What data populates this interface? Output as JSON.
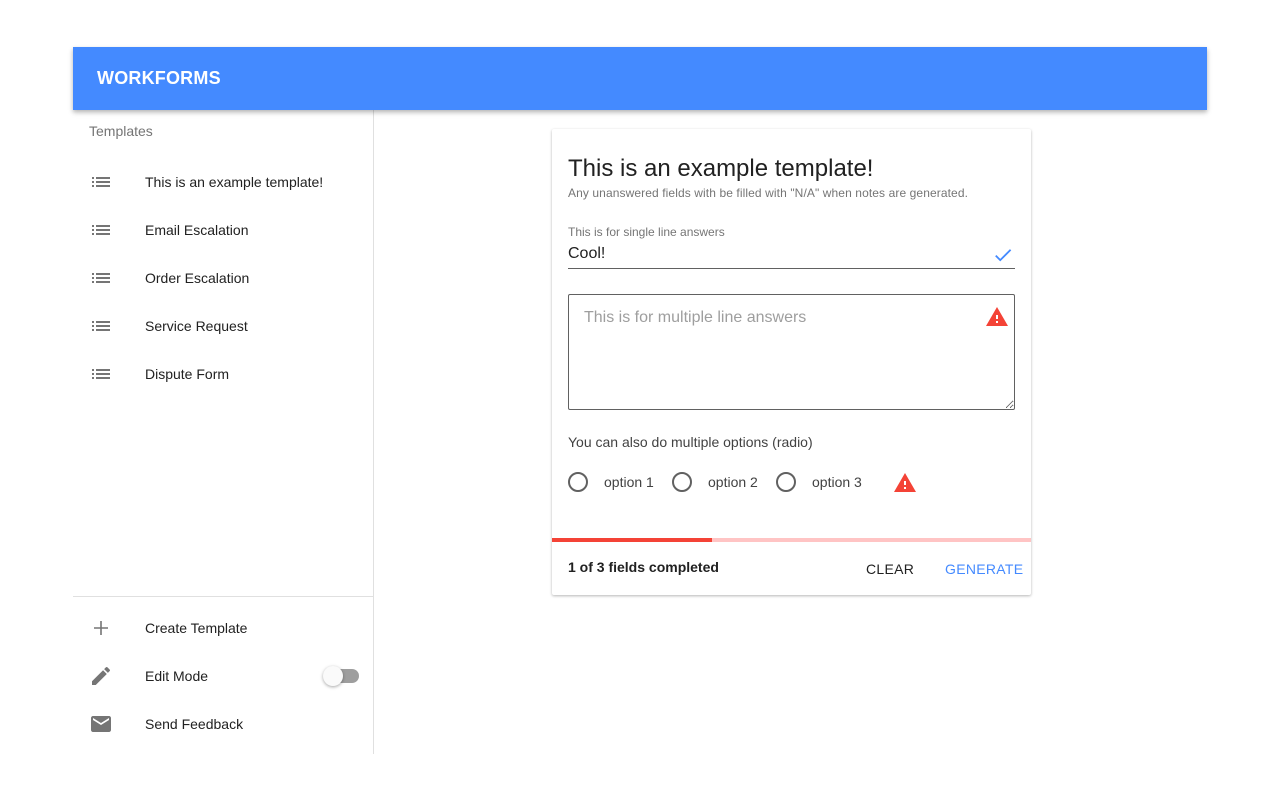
{
  "app": {
    "title": "WORKFORMS",
    "accent_color": "#448aff"
  },
  "sidebar": {
    "subheader": "Templates",
    "templates": [
      {
        "label": "This is an example template!",
        "icon": "list-icon"
      },
      {
        "label": "Email Escalation",
        "icon": "list-icon"
      },
      {
        "label": "Order Escalation",
        "icon": "list-icon"
      },
      {
        "label": "Service Request",
        "icon": "list-icon"
      },
      {
        "label": "Dispute Form",
        "icon": "list-icon"
      }
    ],
    "actions": [
      {
        "label": "Create Template",
        "icon": "plus-icon"
      },
      {
        "label": "Edit Mode",
        "icon": "pencil-icon",
        "toggle": false
      },
      {
        "label": "Send Feedback",
        "icon": "mail-icon"
      }
    ]
  },
  "form": {
    "title": "This is an example template!",
    "subtitle": "Any unanswered fields with be filled with \"N/A\" when notes are generated.",
    "single_line": {
      "label": "This is for single line answers",
      "value": "Cool!",
      "status_icon": "check-icon"
    },
    "multi_line": {
      "placeholder": "This is for multiple line answers",
      "value": "",
      "status_icon": "warning-icon"
    },
    "radio": {
      "label": "You can also do multiple options (radio)",
      "options": [
        "option 1",
        "option 2",
        "option 3"
      ],
      "selected": null,
      "status_icon": "warning-icon"
    }
  },
  "footer": {
    "status": "1 of 3 fields completed",
    "progress": 0.333,
    "progress_color": "#f44336",
    "progress_track_color": "#ffc4c4",
    "clear_label": "CLEAR",
    "generate_label": "GENERATE"
  }
}
